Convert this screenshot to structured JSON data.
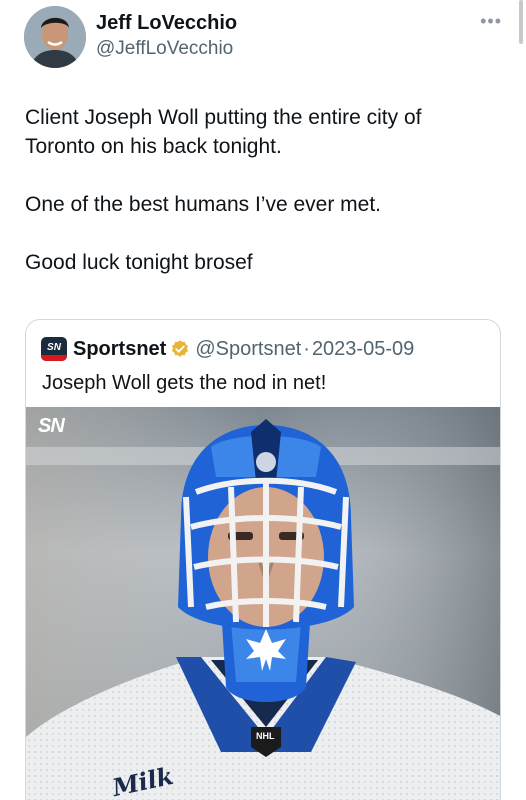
{
  "tweet": {
    "author": {
      "name": "Jeff LoVecchio",
      "handle": "@JeffLoVecchio",
      "avatar_icon": "profile-photo"
    },
    "more_icon": "more-options-icon",
    "paragraphs": [
      "Client Joseph Woll putting the entire city of Toronto on his back tonight.",
      "One of the best humans I’ve ever met.",
      "Good luck tonight brosef"
    ]
  },
  "quote": {
    "logo_text": "SN",
    "name": "Sportsnet",
    "verified_icon": "gold-verified-badge",
    "handle": "@Sportsnet",
    "separator": "·",
    "date": "2023-05-09",
    "text": "Joseph Woll gets the nod in net!",
    "media": {
      "watermark": "SN",
      "jersey_text": "Milk",
      "crest": "NHL",
      "description_icon": "goalie-mask-photo"
    }
  },
  "colors": {
    "text": "#0f1419",
    "secondary": "#536471",
    "border": "#cfd9de",
    "mask_blue": "#1f63d6",
    "verified_gold": "#e8b43a"
  }
}
